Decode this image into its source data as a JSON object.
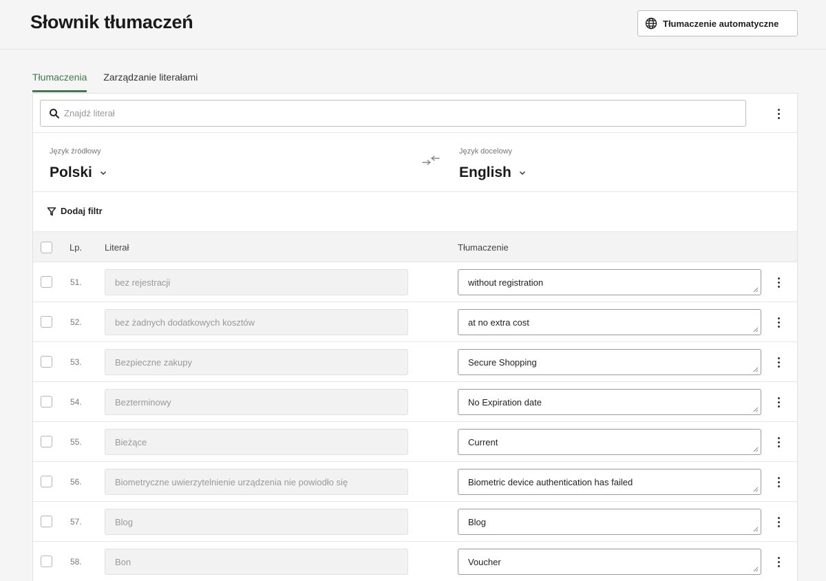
{
  "header": {
    "title": "Słownik tłumaczeń",
    "auto_translate_label": "Tłumaczenie automatyczne"
  },
  "tabs": [
    {
      "label": "Tłumaczenia",
      "active": true
    },
    {
      "label": "Zarządzanie literałami",
      "active": false
    }
  ],
  "search": {
    "placeholder": "Znajdź literał",
    "value": ""
  },
  "languages": {
    "source_label": "Język źródłowy",
    "source_value": "Polski",
    "target_label": "Język docelowy",
    "target_value": "English"
  },
  "filter": {
    "label": "Dodaj filtr"
  },
  "table": {
    "columns": {
      "number": "Lp.",
      "literal": "Literał",
      "translation": "Tłumaczenie"
    },
    "rows": [
      {
        "number": "51.",
        "literal": "bez rejestracji",
        "translation": "without registration"
      },
      {
        "number": "52.",
        "literal": "bez żadnych dodatkowych kosztów",
        "translation": "at no extra cost"
      },
      {
        "number": "53.",
        "literal": "Bezpieczne zakupy",
        "translation": "Secure Shopping"
      },
      {
        "number": "54.",
        "literal": "Bezterminowy",
        "translation": "No Expiration date"
      },
      {
        "number": "55.",
        "literal": "Bieżące",
        "translation": "Current"
      },
      {
        "number": "56.",
        "literal": "Biometryczne uwierzytelnienie urządzenia nie powiodło się",
        "translation": "Biometric device authentication has failed"
      },
      {
        "number": "57.",
        "literal": "Blog",
        "translation": "Blog"
      },
      {
        "number": "58.",
        "literal": "Bon",
        "translation": "Voucher"
      }
    ]
  },
  "icons": {
    "globe": "globe-icon",
    "search": "search-icon",
    "kebab": "kebab-menu-icon",
    "swap": "swap-arrows-icon",
    "chevron": "chevron-down-icon",
    "filter": "filter-icon"
  },
  "colors": {
    "accent": "#3d7a4e",
    "background": "#f5f5f5"
  }
}
